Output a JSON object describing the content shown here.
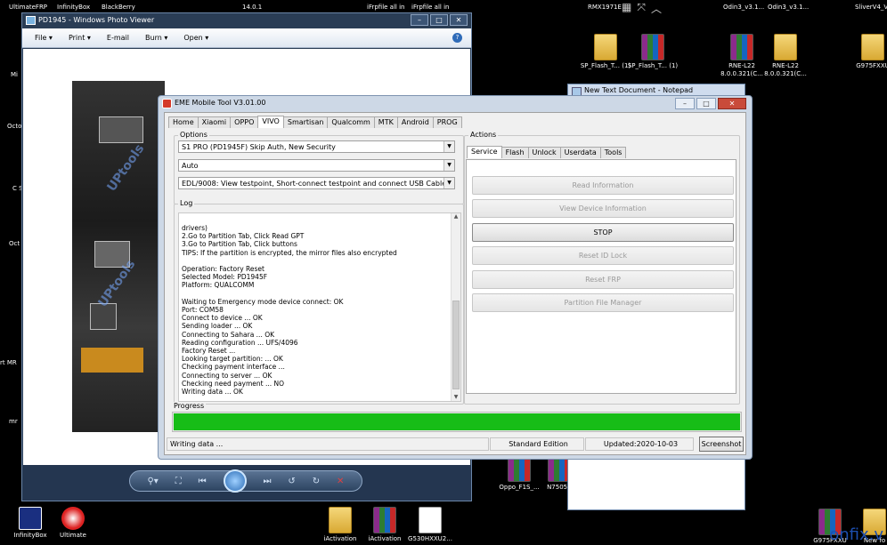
{
  "desktop": {
    "top_labels": [
      "UltimateFRP",
      "InfinityBox",
      "BlackBerry",
      "14.0.1",
      "iFrpfile all in",
      "iFrpfile all in",
      "RMX1971E",
      "Odin3_v3.1...",
      "Odin3_v3.1...",
      "SliverV4_V"
    ],
    "left_labels": [
      "Mi",
      "Octo",
      "C S",
      "Oct",
      "rt MR",
      "mr",
      "InfinityBox_",
      "Ultimate"
    ],
    "icons": [
      {
        "label": "SP_Flash_T... (1)",
        "kind": "folder"
      },
      {
        "label": "SP_Flash_T... (1)",
        "kind": "rar"
      },
      {
        "label": "RNE-L22 8.0.0.321(C...",
        "kind": "rar"
      },
      {
        "label": "RNE-L22 8.0.0.321(C...",
        "kind": "folder"
      },
      {
        "label": "G975FXXU",
        "kind": "folder"
      },
      {
        "label": "Oppo_F1S_...",
        "kind": "rar"
      },
      {
        "label": "N7505X",
        "kind": "rar"
      },
      {
        "label": "InfinityBox",
        "kind": "app"
      },
      {
        "label": "Ultimate",
        "kind": "app"
      },
      {
        "label": "iActivation",
        "kind": "folder"
      },
      {
        "label": "iActivation",
        "kind": "rar"
      },
      {
        "label": "G530HXXU2...",
        "kind": "file"
      },
      {
        "label": "G975FXXU",
        "kind": "rar"
      },
      {
        "label": "New fo",
        "kind": "folder"
      }
    ],
    "watermark": "onfix.v"
  },
  "photo_viewer": {
    "title": "PD1945 - Windows Photo Viewer",
    "menu": [
      "File",
      "Print",
      "E-mail",
      "Burn",
      "Open"
    ],
    "help_icon": "?",
    "photo_watermark": "UPtools",
    "window_controls": {
      "min": "–",
      "max": "□",
      "close": "✕"
    }
  },
  "notepad": {
    "title": "New Text Document - Notepad"
  },
  "eme": {
    "title": "EME Mobile Tool V3.01.00",
    "window_controls": {
      "min": "–",
      "max": "□",
      "close": "✕"
    },
    "tabs": [
      "Home",
      "Xiaomi",
      "OPPO",
      "VIVO",
      "Smartisan",
      "Qualcomm",
      "MTK",
      "Android",
      "PROG"
    ],
    "active_tab": "VIVO",
    "options_label": "Options",
    "model_select": "S1 PRO (PD1945F) Skip Auth, New Security",
    "mode_select": "Auto",
    "edl_select": "EDL/9008: View testpoint, Short-connect testpoint and connect USB Cable",
    "log_label": "Log",
    "log_lines": [
      "drivers)",
      "2.Go to Partition Tab, Click Read GPT",
      "3.Go to Partition Tab, Click buttons",
      "TIPS: If the partition is encrypted, the mirror files also encrypted",
      "",
      "Operation: Factory Reset",
      "Selected Model: PD1945F",
      "Platform: QUALCOMM",
      "",
      "Waiting to Emergency mode device connect: OK",
      "Port: COM58",
      "Connect to device ... OK",
      "Sending loader ... OK",
      "Connecting to Sahara ... OK",
      "Reading configuration ... UFS/4096",
      "Factory Reset ...",
      "Looking target partition: ... OK",
      "Checking payment interface ...",
      "Connecting to server ... OK",
      "Checking need payment ... NO",
      "Writing data ... OK"
    ],
    "actions_label": "Actions",
    "action_tabs": [
      "Service",
      "Flash",
      "Unlock",
      "Userdata",
      "Tools"
    ],
    "active_action_tab": "Service",
    "action_buttons": [
      {
        "label": "Read Information",
        "enabled": false
      },
      {
        "label": "View Device Information",
        "enabled": false
      },
      {
        "label": "STOP",
        "enabled": true
      },
      {
        "label": "Reset ID Lock",
        "enabled": false
      },
      {
        "label": "Reset FRP",
        "enabled": false
      },
      {
        "label": "Partition File Manager",
        "enabled": false
      }
    ],
    "progress_label": "Progress",
    "progress_fraction": 1.0,
    "progress_color": "#17bd17",
    "status": {
      "message": "Writing data ...",
      "edition": "Standard Edition",
      "updated": "Updated:2020-10-03",
      "screenshot_button": "Screenshot"
    }
  }
}
